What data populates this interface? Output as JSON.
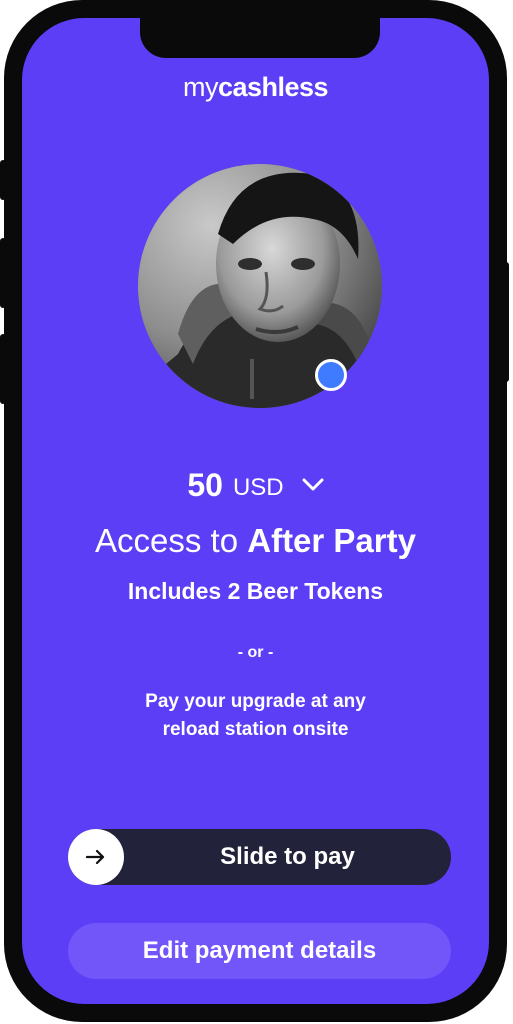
{
  "app": {
    "logo_light": "my",
    "logo_bold": "cashless"
  },
  "profile": {
    "avatar": "user-photo-grayscale",
    "status_color": "#3f7bff"
  },
  "payment": {
    "amount": "50",
    "currency": "USD",
    "title_light": "Access to",
    "title_bold": "After Party",
    "subtitle": "Includes 2 Beer Tokens",
    "separator": "- or -",
    "note_line1": "Pay your upgrade at any",
    "note_line2": "reload station onsite"
  },
  "actions": {
    "slide_label": "Slide to pay",
    "slide_icon": "arrow-right-icon",
    "edit_label": "Edit payment details"
  },
  "colors": {
    "background": "#5b3ef6",
    "slider": "#22223a",
    "edit_button": "#7256fa"
  }
}
